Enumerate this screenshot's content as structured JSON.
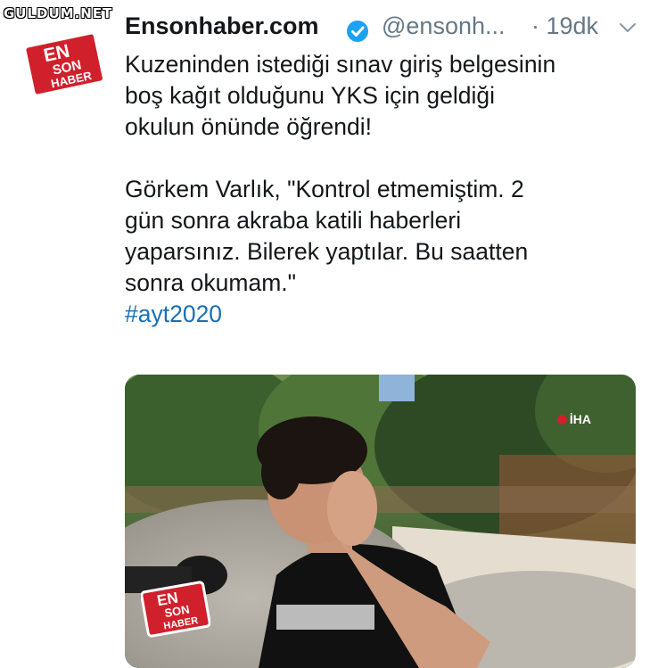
{
  "watermark": "GULDUM.NET",
  "avatar": {
    "line1": "EN",
    "line2": "SON",
    "line3": "HABER"
  },
  "tweet": {
    "author_name": "Ensonhaber.com",
    "handle": "@ensonh...",
    "time": "· 19dk",
    "paragraph1": [
      "Kuzeninden istediği sınav giriş belgesinin",
      "boş kağıt olduğunu YKS için geldiği",
      "okulun önünde öğrendi!"
    ],
    "paragraph2": [
      "Görkem Varlık, \"Kontrol etmemiştim. 2",
      "gün sonra akraba katili haberleri",
      "yaparsınız. Bilerek yaptılar. Bu saatten",
      "sonra okumam.\""
    ],
    "hashtag": "#ayt2020"
  },
  "media": {
    "agency": "İHA",
    "logo": {
      "line1": "EN",
      "line2": "SON",
      "line3": "HABER"
    }
  },
  "colors": {
    "brand_red": "#d0202b",
    "link_blue": "#1b6fb2",
    "verified_blue": "#1da1f2",
    "muted": "#657786"
  },
  "icons": [
    "verified-badge-icon",
    "chevron-down-icon",
    "iha-logo-icon"
  ]
}
